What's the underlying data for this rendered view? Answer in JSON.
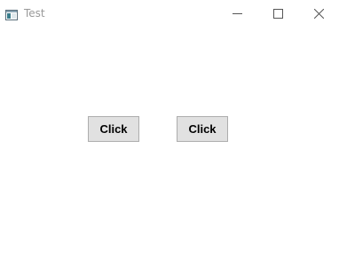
{
  "window": {
    "title": "Test"
  },
  "titlebar": {
    "icon": "window-app-icon",
    "controls": [
      "minimize-icon",
      "maximize-icon",
      "close-icon"
    ]
  },
  "buttons": [
    {
      "label": "Click"
    },
    {
      "label": "Click"
    }
  ]
}
